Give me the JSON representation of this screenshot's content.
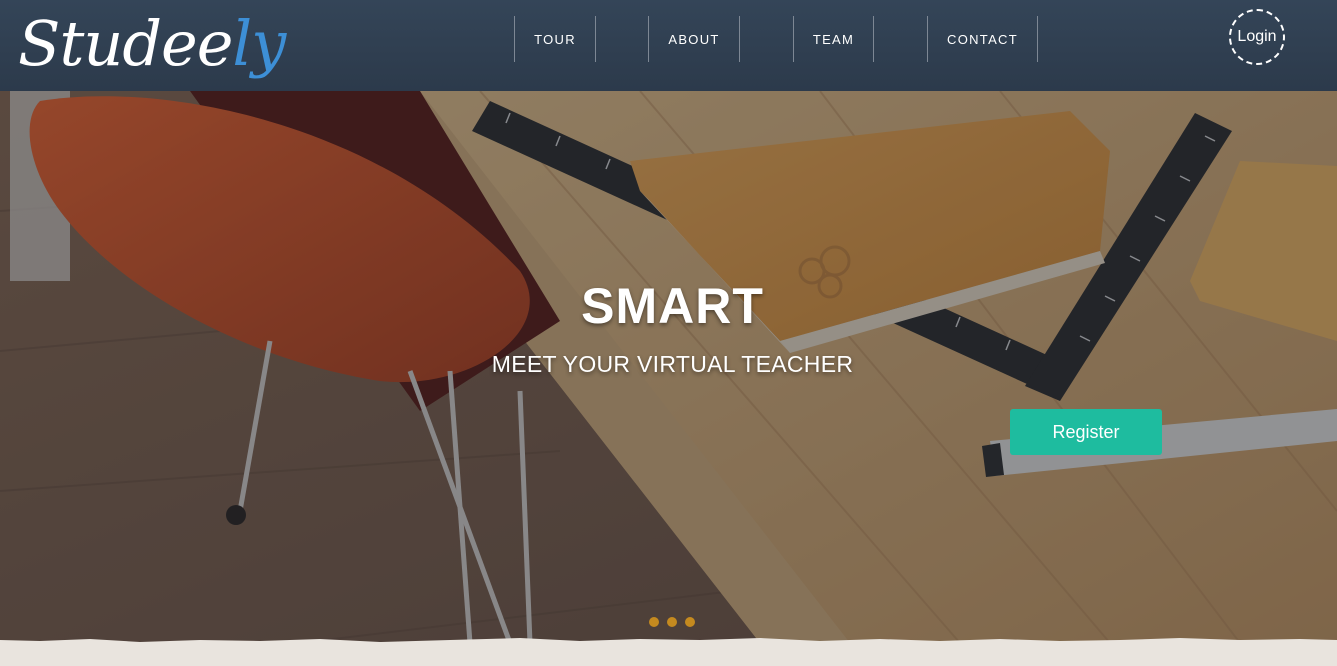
{
  "header": {
    "logo": {
      "part_a": "Studee",
      "part_b": "ly"
    },
    "nav": [
      {
        "label": "TOUR"
      },
      {
        "label": "ABOUT"
      },
      {
        "label": "TEAM"
      },
      {
        "label": "CONTACT"
      }
    ],
    "login_label": "Login"
  },
  "hero": {
    "title": "SMART",
    "subtitle": "MEET YOUR VIRTUAL TEACHER",
    "register_label": "Register",
    "slide_count": 3
  },
  "colors": {
    "header": "#2f3d4f",
    "logo_accent": "#3d8fd6",
    "register": "#1ebc9f",
    "slider_dot": "#c58a1f",
    "page_bg": "#e9e4de"
  }
}
